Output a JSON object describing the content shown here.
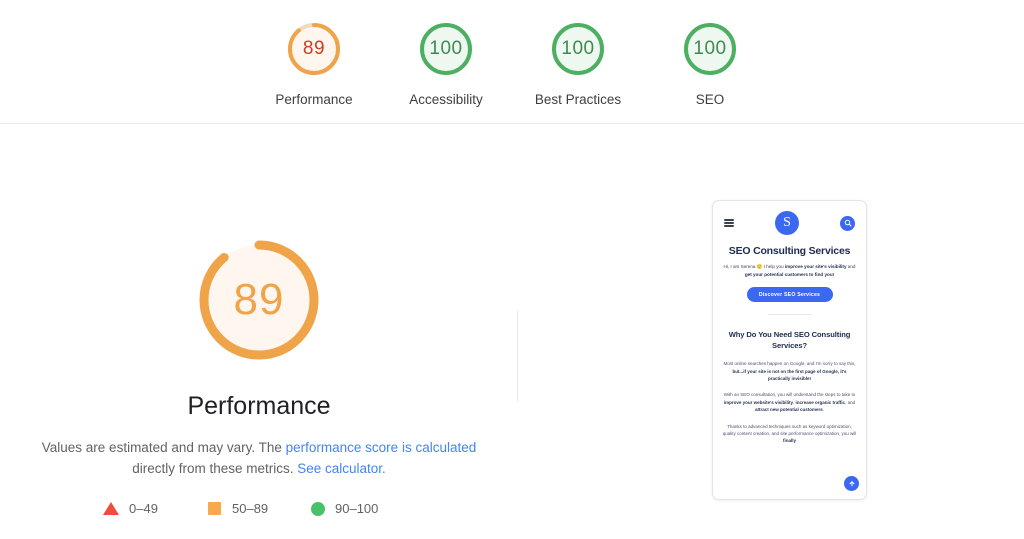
{
  "scorebar": {
    "items": [
      {
        "label": "Performance",
        "score": 89,
        "color": "#f0a44a",
        "track": "#f5d9b8",
        "fill": "#fef6ef",
        "text_color": "#c8401f",
        "icon": "gauge-icon"
      },
      {
        "label": "Accessibility",
        "score": 100,
        "color": "#4caf62",
        "track": "#4caf62",
        "fill": "#eef8f0",
        "text_color": "#3f8a52",
        "icon": "gauge-icon"
      },
      {
        "label": "Best Practices",
        "score": 100,
        "color": "#4caf62",
        "track": "#4caf62",
        "fill": "#eef8f0",
        "text_color": "#3f8a52",
        "icon": "gauge-icon"
      },
      {
        "label": "SEO",
        "score": 100,
        "color": "#4caf62",
        "track": "#4caf62",
        "fill": "#eef8f0",
        "text_color": "#3f8a52",
        "icon": "gauge-icon"
      }
    ]
  },
  "main": {
    "gauge": {
      "score": 89,
      "color": "#f0a44a",
      "fill": "#fef6ef"
    },
    "category_title": "Performance",
    "description_part1": "Values are estimated and may vary. The ",
    "description_link1": "performance score is calculated",
    "description_part2": " directly from these metrics. ",
    "description_link2": "See calculator.",
    "legend": [
      {
        "icon": "triangle-icon",
        "shape": "triangle",
        "color": "#f24c3d",
        "label": "0–49"
      },
      {
        "icon": "square-icon",
        "shape": "square",
        "color": "#f7a94b",
        "label": "50–89"
      },
      {
        "icon": "circle-icon",
        "shape": "circle",
        "color": "#49c16b",
        "label": "90–100"
      }
    ]
  },
  "thumbnail": {
    "nav": {
      "menu_icon": "hamburger-menu-icon",
      "logo_text": "S",
      "search_icon": "search-icon"
    },
    "heading": "SEO Consulting Services",
    "subheading_line1": "Hi, I am Serena 🙂 I help you ",
    "subheading_bold1": "improve your site's visibility",
    "subheading_line2": " and",
    "subheading_bold2": "get your potential customers to find you!",
    "cta_label": "Discover SEO Services",
    "section_heading": "Why Do You Need SEO Consulting Services?",
    "paragraph1_a": "Most online searches happen on Google, and I'm sorry to say this,",
    "paragraph1_b": "but...if your site is not on the first page of Google, it's practically invisible!",
    "paragraph2_a": "With an SEO consultation, you will understand the steps to take to ",
    "paragraph2_b1": "improve your website's visibility",
    "paragraph2_c": ", ",
    "paragraph2_b2": "increase organic traffic",
    "paragraph2_d": ", and ",
    "paragraph2_b3": "attract new potential customers",
    "paragraph2_e": ".",
    "paragraph3_a": "Thanks to advanced techniques such as keyword optimization, quality content creation, and site performance optimization, you will ",
    "paragraph3_b": "finally",
    "fab_icon": "scroll-to-top-icon",
    "fab_glyph": "▲"
  }
}
